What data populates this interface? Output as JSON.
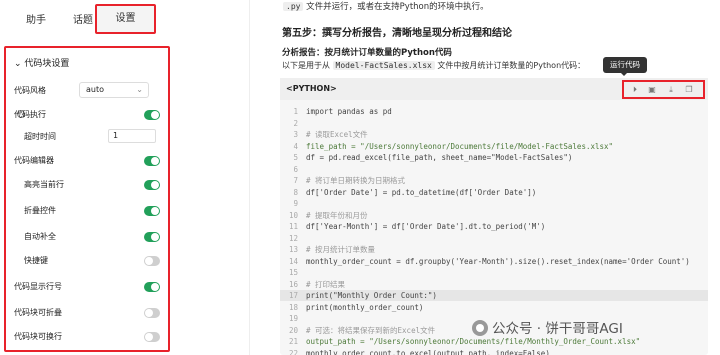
{
  "tabs": [
    "助手",
    "话题",
    "设置"
  ],
  "panel": {
    "title": "代码块设置",
    "rows": [
      {
        "label": "代码风格",
        "control": "select",
        "value": "auto"
      },
      {
        "label": "代码执行",
        "control": "switch",
        "on": true,
        "help": "?"
      },
      {
        "label": "超时时间",
        "control": "number",
        "value": "1",
        "indent": true
      },
      {
        "label": "代码编辑器",
        "control": "switch",
        "on": true
      },
      {
        "label": "高亮当前行",
        "control": "switch",
        "on": true,
        "indent": true
      },
      {
        "label": "折叠控件",
        "control": "switch",
        "on": true,
        "indent": true
      },
      {
        "label": "自动补全",
        "control": "switch",
        "on": true,
        "indent": true
      },
      {
        "label": "快捷键",
        "control": "switch",
        "on": false,
        "indent": true
      },
      {
        "label": "代码显示行号",
        "control": "switch",
        "on": true
      },
      {
        "label": "代码块可折叠",
        "control": "switch",
        "on": false
      },
      {
        "label": "代码块可换行",
        "control": "switch",
        "on": false
      }
    ]
  },
  "article": {
    "line1_code": ".py",
    "line1_text": "文件并运行，或者在支持Python的环境中执行。",
    "step": "第五步：撰写分析报告，清晰地呈现分析过程和结论",
    "report_title": "分析报告：按月统计订单数量的Python代码",
    "desc_a": "以下是用于从",
    "desc_code": "Model-FactSales.xlsx",
    "desc_b": "文件中按月统计订单数量的Python代码："
  },
  "code": {
    "language": "<PYTHON>",
    "tooltip": "运行代码",
    "toolbar_icons": [
      "play-icon",
      "save-icon",
      "download-icon",
      "copy-icon"
    ],
    "lines": [
      {
        "n": "1",
        "t": "import pandas as pd",
        "k": ""
      },
      {
        "n": "2",
        "t": "",
        "k": ""
      },
      {
        "n": "3",
        "t": "# 读取Excel文件",
        "k": "c"
      },
      {
        "n": "4",
        "t": "file_path = \"/Users/sonnyleonor/Documents/file/Model-FactSales.xlsx\"",
        "k": "s"
      },
      {
        "n": "5",
        "t": "df = pd.read_excel(file_path, sheet_name=\"Model-FactSales\")",
        "k": ""
      },
      {
        "n": "6",
        "t": "",
        "k": ""
      },
      {
        "n": "7",
        "t": "# 将订单日期转换为日期格式",
        "k": "c"
      },
      {
        "n": "8",
        "t": "df['Order Date'] = pd.to_datetime(df['Order Date'])",
        "k": ""
      },
      {
        "n": "9",
        "t": "",
        "k": ""
      },
      {
        "n": "10",
        "t": "# 提取年份和月份",
        "k": "c"
      },
      {
        "n": "11",
        "t": "df['Year-Month'] = df['Order Date'].dt.to_period('M')",
        "k": ""
      },
      {
        "n": "12",
        "t": "",
        "k": ""
      },
      {
        "n": "13",
        "t": "# 按月统计订单数量",
        "k": "c"
      },
      {
        "n": "14",
        "t": "monthly_order_count = df.groupby('Year-Month').size().reset_index(name='Order Count')",
        "k": ""
      },
      {
        "n": "15",
        "t": "",
        "k": ""
      },
      {
        "n": "16",
        "t": "# 打印结果",
        "k": "c"
      },
      {
        "n": "17",
        "t": "print(\"Monthly Order Count:\")",
        "k": "",
        "hl": true
      },
      {
        "n": "18",
        "t": "print(monthly_order_count)",
        "k": ""
      },
      {
        "n": "19",
        "t": "",
        "k": ""
      },
      {
        "n": "20",
        "t": "# 可选：将结果保存到新的Excel文件",
        "k": "c"
      },
      {
        "n": "21",
        "t": "output_path = \"/Users/sonnyleonor/Documents/file/Monthly_Order_Count.xlsx\"",
        "k": "s"
      },
      {
        "n": "22",
        "t": "monthly_order_count.to_excel(output_path, index=False)",
        "k": ""
      }
    ]
  },
  "watermark": "公众号 · 饼干哥哥AGI"
}
